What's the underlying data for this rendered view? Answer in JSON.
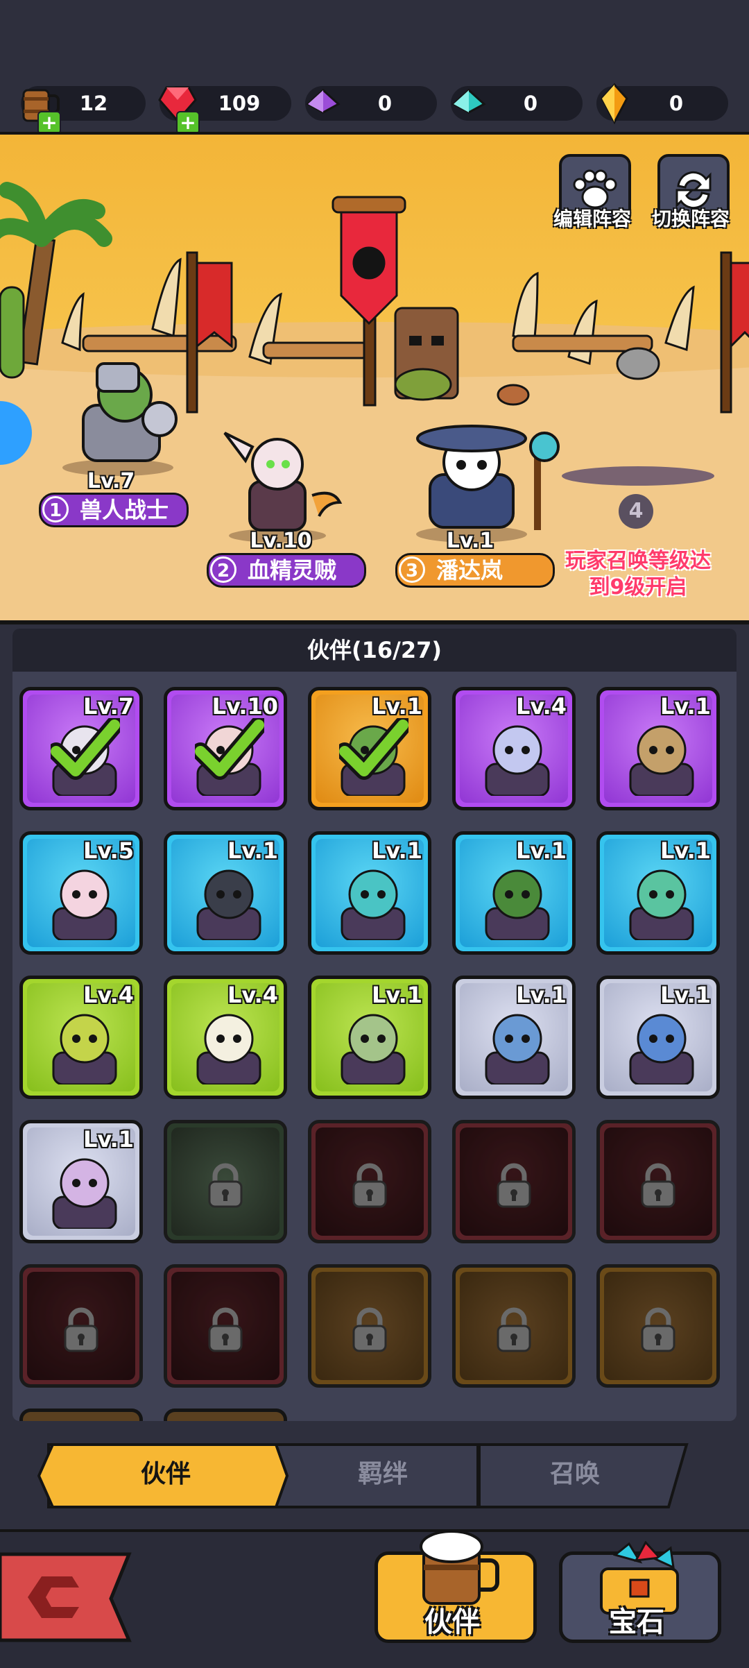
{
  "currencies": [
    {
      "name": "ale",
      "value": "12",
      "icon": "ale-mug-icon",
      "has_plus": true
    },
    {
      "name": "ruby",
      "value": "109",
      "icon": "red-gem-icon",
      "has_plus": true
    },
    {
      "name": "purple-crystal",
      "value": "0",
      "icon": "purple-crystal-icon",
      "has_plus": false
    },
    {
      "name": "cyan-crystal",
      "value": "0",
      "icon": "cyan-crystal-icon",
      "has_plus": false
    },
    {
      "name": "amber",
      "value": "0",
      "icon": "amber-gem-icon",
      "has_plus": false
    }
  ],
  "scene": {
    "edit_lineup_label": "编辑阵容",
    "switch_lineup_label": "切换阵容",
    "heroes": [
      {
        "slot": "1",
        "level": "Lv.7",
        "name": "兽人战士",
        "plate": "purple"
      },
      {
        "slot": "2",
        "level": "Lv.10",
        "name": "血精灵贼",
        "plate": "purple"
      },
      {
        "slot": "3",
        "level": "Lv.1",
        "name": "潘达岚",
        "plate": "orange"
      }
    ],
    "locked_slot_number": "4",
    "unlock_hint_line1": "玩家召唤等级达",
    "unlock_hint_line2": "到9级开启"
  },
  "roster": {
    "title": "伙伴(16/27)",
    "cards": [
      {
        "level": "Lv.7",
        "rarity": "purple",
        "selected": true,
        "locked": false
      },
      {
        "level": "Lv.10",
        "rarity": "purple",
        "selected": true,
        "locked": false
      },
      {
        "level": "Lv.1",
        "rarity": "orange",
        "selected": true,
        "locked": false
      },
      {
        "level": "Lv.4",
        "rarity": "purple",
        "selected": false,
        "locked": false
      },
      {
        "level": "Lv.1",
        "rarity": "purple",
        "selected": false,
        "locked": false
      },
      {
        "level": "Lv.5",
        "rarity": "blue",
        "selected": false,
        "locked": false
      },
      {
        "level": "Lv.1",
        "rarity": "blue",
        "selected": false,
        "locked": false
      },
      {
        "level": "Lv.1",
        "rarity": "blue",
        "selected": false,
        "locked": false
      },
      {
        "level": "Lv.1",
        "rarity": "blue",
        "selected": false,
        "locked": false
      },
      {
        "level": "Lv.1",
        "rarity": "blue",
        "selected": false,
        "locked": false
      },
      {
        "level": "Lv.4",
        "rarity": "green",
        "selected": false,
        "locked": false
      },
      {
        "level": "Lv.4",
        "rarity": "green",
        "selected": false,
        "locked": false
      },
      {
        "level": "Lv.1",
        "rarity": "green",
        "selected": false,
        "locked": false
      },
      {
        "level": "Lv.1",
        "rarity": "white",
        "selected": false,
        "locked": false
      },
      {
        "level": "Lv.1",
        "rarity": "white",
        "selected": false,
        "locked": false
      },
      {
        "level": "Lv.1",
        "rarity": "white",
        "selected": false,
        "locked": false
      },
      {
        "level": "",
        "rarity": "green",
        "selected": false,
        "locked": true
      },
      {
        "level": "",
        "rarity": "red",
        "selected": false,
        "locked": true
      },
      {
        "level": "",
        "rarity": "red",
        "selected": false,
        "locked": true
      },
      {
        "level": "",
        "rarity": "red",
        "selected": false,
        "locked": true
      },
      {
        "level": "",
        "rarity": "red",
        "selected": false,
        "locked": true
      },
      {
        "level": "",
        "rarity": "red",
        "selected": false,
        "locked": true
      },
      {
        "level": "",
        "rarity": "orange",
        "selected": false,
        "locked": true
      },
      {
        "level": "",
        "rarity": "orange",
        "selected": false,
        "locked": true
      },
      {
        "level": "",
        "rarity": "orange",
        "selected": false,
        "locked": true
      }
    ]
  },
  "tabs": [
    {
      "label": "伙伴",
      "active": true
    },
    {
      "label": "羁绊",
      "active": false
    },
    {
      "label": "召唤",
      "active": false
    }
  ],
  "bottom_nav": {
    "back_icon": "back-flag-icon",
    "partner_label": "伙伴",
    "gem_label": "宝石"
  },
  "colors": {
    "purple": "#b14cf0",
    "orange": "#f4a01f",
    "blue": "#35c4ee",
    "green": "#a4d62d",
    "white": "#c9cde0",
    "red": "#b83a3a",
    "tab_active": "#f7b733",
    "accent_red": "#ff3b6b"
  }
}
